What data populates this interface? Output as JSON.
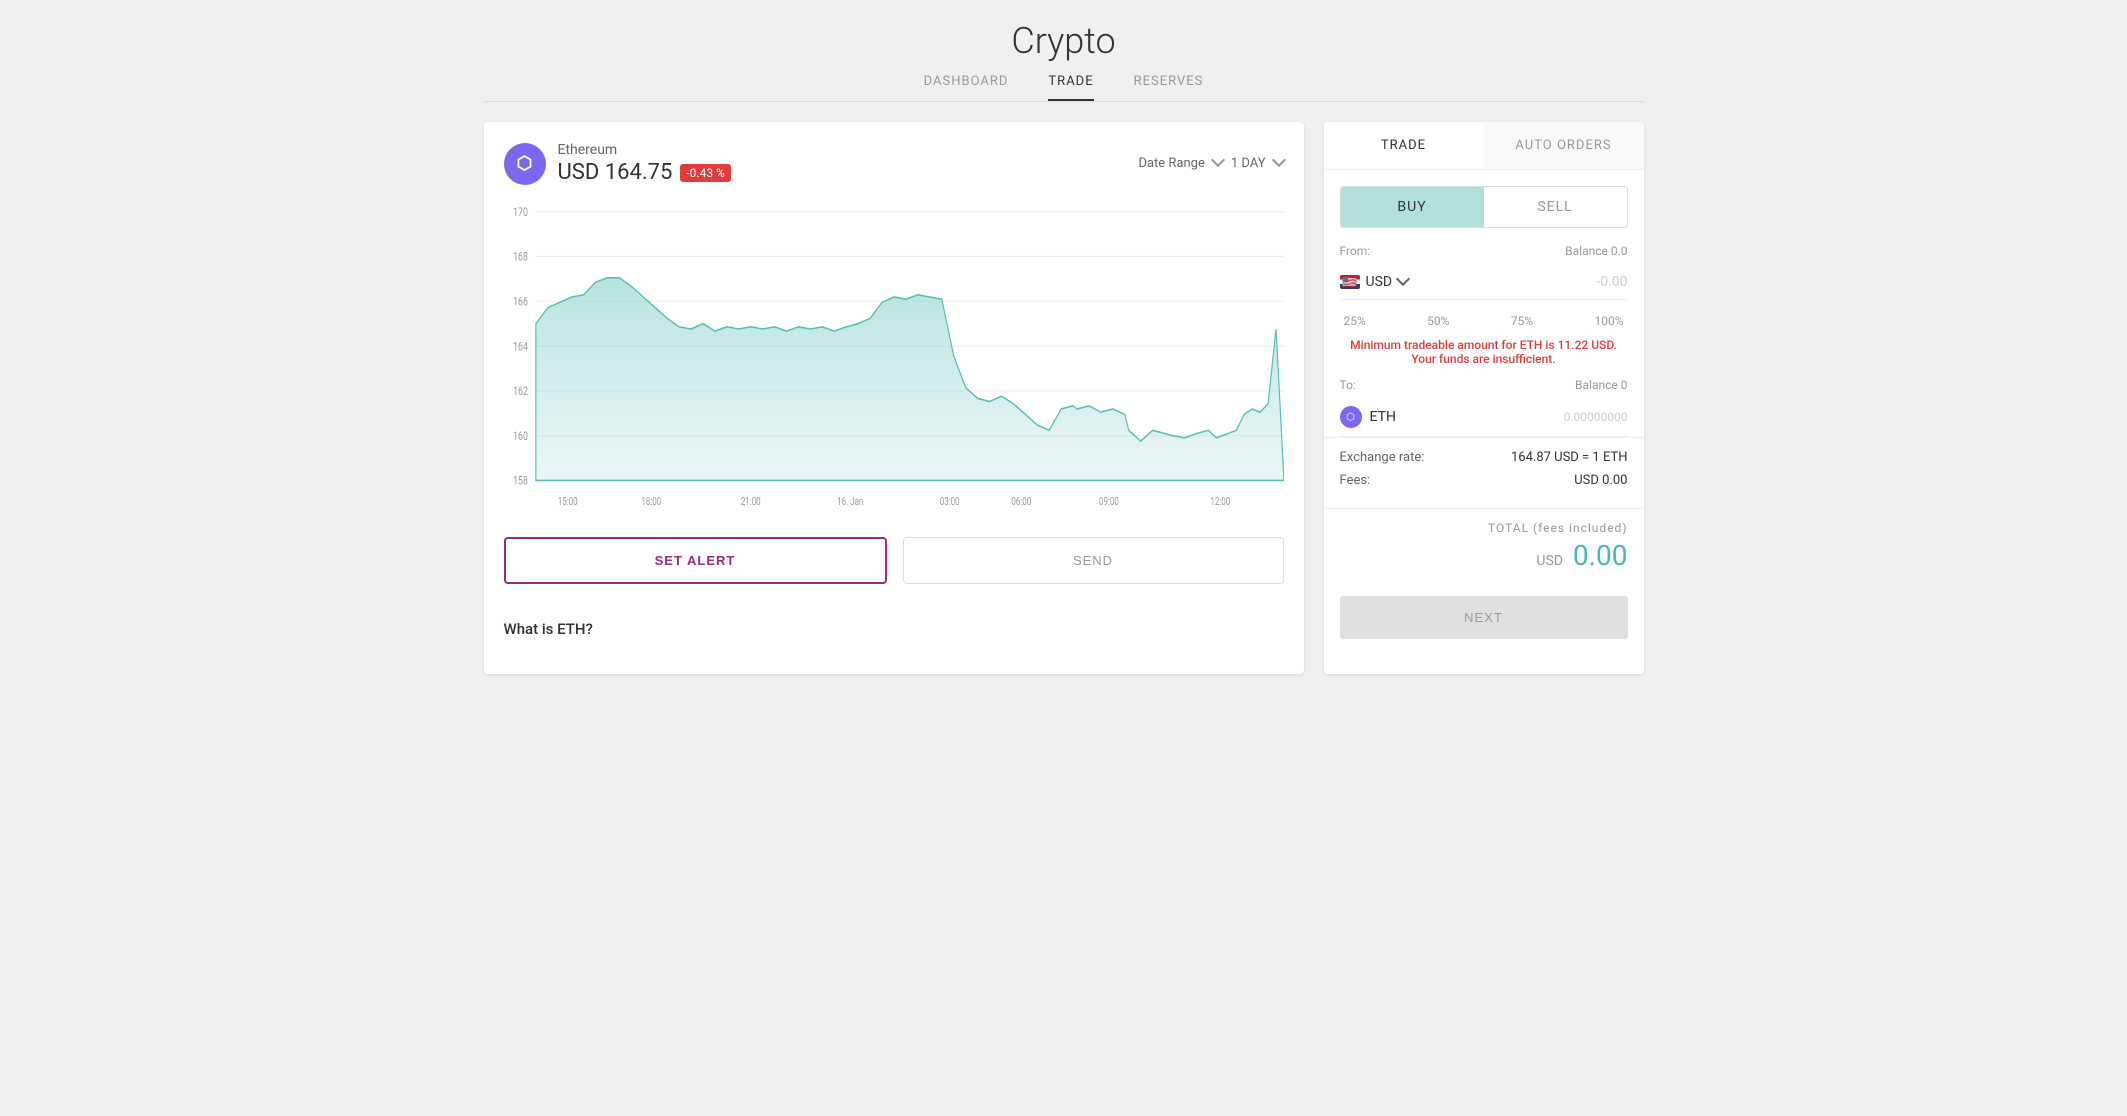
{
  "page": {
    "title": "Crypto"
  },
  "nav": {
    "tabs": [
      {
        "label": "DASHBOARD",
        "active": false
      },
      {
        "label": "TRADE",
        "active": true
      },
      {
        "label": "RESERVES",
        "active": false
      }
    ]
  },
  "chart": {
    "coin_name": "Ethereum",
    "coin_symbol": "ETH",
    "coin_price": "USD 164.75",
    "price_change": "-0.43 %",
    "date_range_label": "Date Range",
    "date_range_value": "1 DAY",
    "y_labels": [
      "170",
      "168",
      "166",
      "164",
      "162",
      "160",
      "158"
    ],
    "x_labels": [
      "15:00",
      "18:00",
      "21:00",
      "16. Jan",
      "03:00",
      "06:00",
      "09:00",
      "12:00"
    ],
    "set_alert_label": "SET ALERT",
    "send_label": "SEND"
  },
  "what_is": {
    "title": "What is ETH?"
  },
  "right_panel": {
    "tabs": [
      "TRADE",
      "AUTO ORDERS"
    ],
    "active_tab": "TRADE",
    "buy_sell": [
      "BUY",
      "SELL"
    ],
    "active_buy_sell": "BUY",
    "from_label": "From:",
    "balance_label": "Balance 0.0",
    "currency_code": "USD",
    "currency_amount": "-0.00",
    "percent_options": [
      "25%",
      "50%",
      "75%",
      "100%"
    ],
    "error_message": "Minimum tradeable amount for ETH is 11.22 USD. Your funds are insufficient.",
    "to_label": "To:",
    "to_balance_label": "Balance 0",
    "eth_label": "ETH",
    "eth_amount": "0.00000000",
    "exchange_rate_label": "Exchange rate:",
    "exchange_rate_value": "164.87 USD = 1 ETH",
    "fees_label": "Fees:",
    "fees_value": "USD 0.00",
    "total_label": "TOTAL (fees included)",
    "total_currency": "USD",
    "total_amount": "0.00",
    "next_label": "NEXT"
  }
}
